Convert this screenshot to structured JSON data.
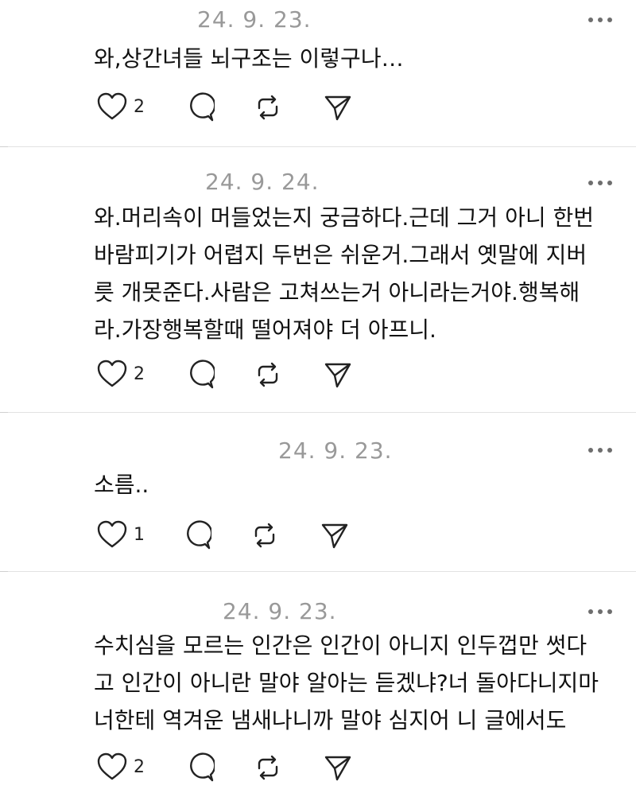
{
  "posts": [
    {
      "date": "24. 9. 23.",
      "lines": [
        "와,상간녀들 뇌구조는 이렇구나…"
      ],
      "likes": "2"
    },
    {
      "date": "24. 9. 24.",
      "lines": [
        "와.머리속이 머들었는지 궁금하다.근데 그거 아니 한번",
        "바람피기가 어렵지 두번은 쉬운거.그래서 옛말에 지버",
        "릇 개못준다.사람은 고쳐쓰는거 아니라는거야.행복해",
        "라.가장행복할때 떨어져야 더 아프니."
      ],
      "likes": "2"
    },
    {
      "date": "24. 9. 23.",
      "lines": [
        "소름.."
      ],
      "likes": "1"
    },
    {
      "date": "24. 9. 23.",
      "lines": [
        "수치심을 모르는 인간은 인간이 아니지 인두껍만 썻다",
        "고 인간이 아니란 말야 알아는 듣겠냐?너 돌아다니지마",
        "너한테 역겨운 냄새나니까 말야 심지어 니 글에서도"
      ],
      "likes": "2"
    }
  ]
}
